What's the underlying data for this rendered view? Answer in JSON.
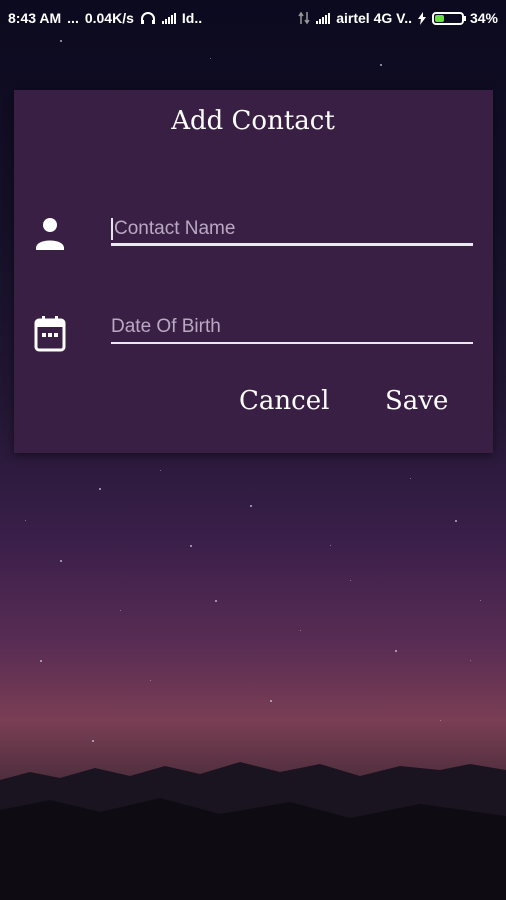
{
  "status_bar": {
    "time": "8:43 AM",
    "dots": "...",
    "net_speed": "0.04K/s",
    "carrier1": "Id..",
    "carrier2": "airtel 4G V..",
    "battery_pct": "34%",
    "battery_level": 0.34,
    "battery_color": "#6bdc4a"
  },
  "dialog": {
    "title": "Add Contact",
    "fields": [
      {
        "icon": "person-icon",
        "placeholder": "Contact Name"
      },
      {
        "icon": "calendar-icon",
        "placeholder": "Date Of Birth"
      }
    ],
    "cancel_label": "Cancel",
    "save_label": "Save",
    "background": "#3a1f44"
  }
}
